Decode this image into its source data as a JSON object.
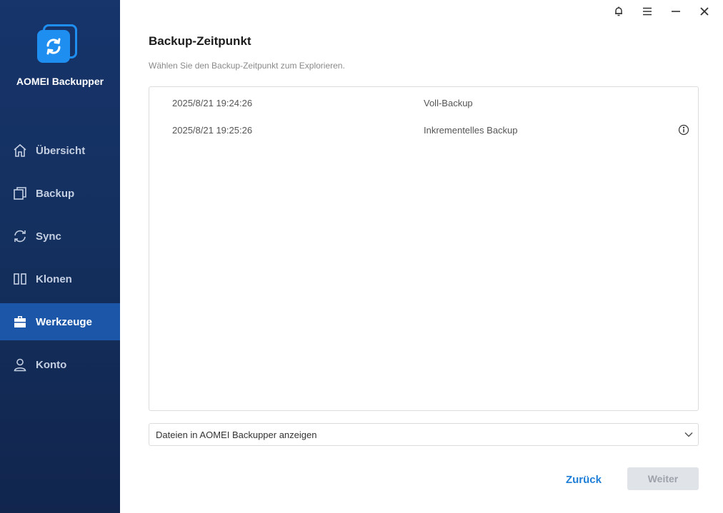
{
  "app": {
    "name": "AOMEI Backupper"
  },
  "sidebar": {
    "items": [
      {
        "id": "overview",
        "label": "Übersicht",
        "icon": "home-icon",
        "active": false
      },
      {
        "id": "backup",
        "label": "Backup",
        "icon": "backup-icon",
        "active": false
      },
      {
        "id": "sync",
        "label": "Sync",
        "icon": "sync-icon",
        "active": false
      },
      {
        "id": "clone",
        "label": "Klonen",
        "icon": "clone-icon",
        "active": false
      },
      {
        "id": "tools",
        "label": "Werkzeuge",
        "icon": "toolbox-icon",
        "active": true
      },
      {
        "id": "account",
        "label": "Konto",
        "icon": "user-icon",
        "active": false
      }
    ]
  },
  "window_controls": [
    "bell-icon",
    "menu-icon",
    "minimize-icon",
    "close-icon"
  ],
  "main": {
    "title": "Backup-Zeitpunkt",
    "subtitle": "Wählen Sie den Backup-Zeitpunkt zum Explorieren.",
    "backups": [
      {
        "time": "2025/8/21 19:24:26",
        "type": "Voll-Backup",
        "info": false
      },
      {
        "time": "2025/8/21 19:25:26",
        "type": "Inkrementelles Backup",
        "info": true
      }
    ],
    "dropdown": {
      "selected": "Dateien in AOMEI Backupper anzeigen"
    },
    "buttons": {
      "back": "Zurück",
      "next": "Weiter"
    }
  },
  "colors": {
    "sidebar_bg": "#14305f",
    "sidebar_active": "#1b56a8",
    "accent": "#1f8ef1",
    "link": "#1f7ed8",
    "disabled_bg": "#e0e3e8"
  }
}
